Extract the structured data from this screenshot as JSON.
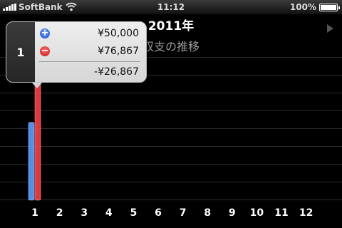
{
  "status_bar": {
    "carrier": "SoftBank",
    "time": "11:12",
    "battery_percent": "100%"
  },
  "header": {
    "title": "2011年",
    "subtitle": "収支の推移"
  },
  "popup": {
    "month": "1",
    "income": "¥50,000",
    "expense": "¥76,867",
    "balance": "-¥26,867"
  },
  "colors": {
    "income_bar": "#4f8ff0",
    "expense_bar": "#e8343b"
  },
  "chart_data": {
    "type": "bar",
    "categories": [
      "1",
      "2",
      "3",
      "4",
      "5",
      "6",
      "7",
      "8",
      "9",
      "10",
      "11",
      "12"
    ],
    "series": [
      {
        "values": [
          50000,
          0,
          0,
          0,
          0,
          0,
          0,
          0,
          0,
          0,
          0,
          0
        ]
      },
      {
        "values": [
          76867,
          0,
          0,
          0,
          0,
          0,
          0,
          0,
          0,
          0,
          0,
          0
        ]
      }
    ],
    "title": "",
    "xlabel": "",
    "ylabel": "",
    "ylim": [
      0,
      80000
    ],
    "grid": true
  }
}
